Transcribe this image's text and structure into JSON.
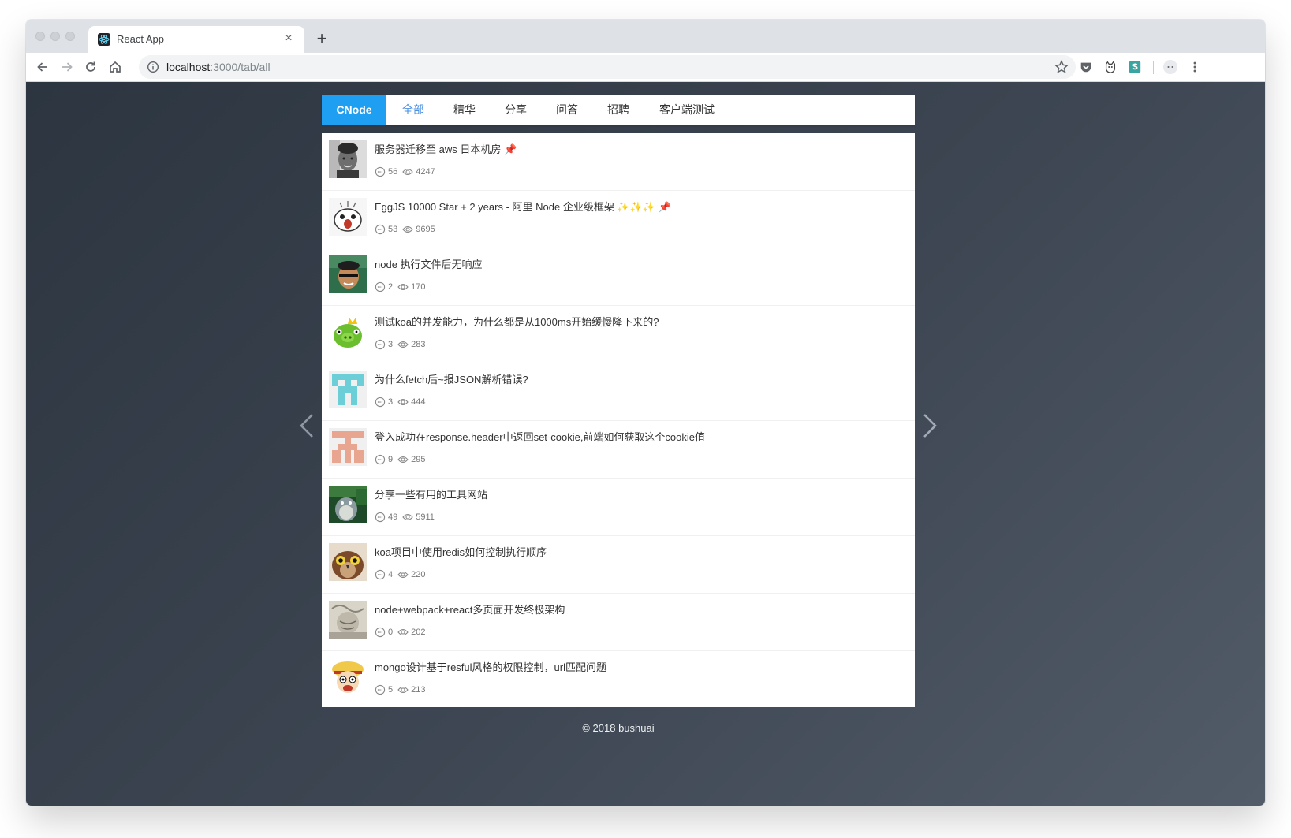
{
  "browser": {
    "tab_title": "React App",
    "tab_close": "×",
    "new_tab": "+",
    "url_host": "localhost",
    "url_rest": ":3000/tab/all"
  },
  "nav": {
    "brand": "CNode",
    "tabs": [
      "全部",
      "精华",
      "分享",
      "问答",
      "招聘",
      "客户端测试"
    ],
    "active_index": 0
  },
  "topics": [
    {
      "title": "服务器迁移至 aws 日本机房 📌",
      "replies": "56",
      "views": "4247"
    },
    {
      "title": "EggJS 10000 Star + 2 years - 阿里 Node 企业级框架 ✨✨✨ 📌",
      "replies": "53",
      "views": "9695"
    },
    {
      "title": "node 执行文件后无响应",
      "replies": "2",
      "views": "170"
    },
    {
      "title": "测试koa的并发能力，为什么都是从1000ms开始缓慢降下来的?",
      "replies": "3",
      "views": "283"
    },
    {
      "title": "为什么fetch后~报JSON解析错误?",
      "replies": "3",
      "views": "444"
    },
    {
      "title": "登入成功在response.header中返回set-cookie,前端如何获取这个cookie值",
      "replies": "9",
      "views": "295"
    },
    {
      "title": "分享一些有用的工具网站",
      "replies": "49",
      "views": "5911"
    },
    {
      "title": "koa项目中使用redis如何控制执行顺序",
      "replies": "4",
      "views": "220"
    },
    {
      "title": "node+webpack+react多页面开发终极架构",
      "replies": "0",
      "views": "202"
    },
    {
      "title": "mongo设计基于resful风格的权限控制，url匹配问题",
      "replies": "5",
      "views": "213"
    }
  ],
  "footer": "© 2018 bushuai",
  "colors": {
    "brand_bg": "#1f9ff2",
    "active_tab": "#4a90e2",
    "page_bg_start": "#2c3540",
    "page_bg_end": "#525c68"
  }
}
